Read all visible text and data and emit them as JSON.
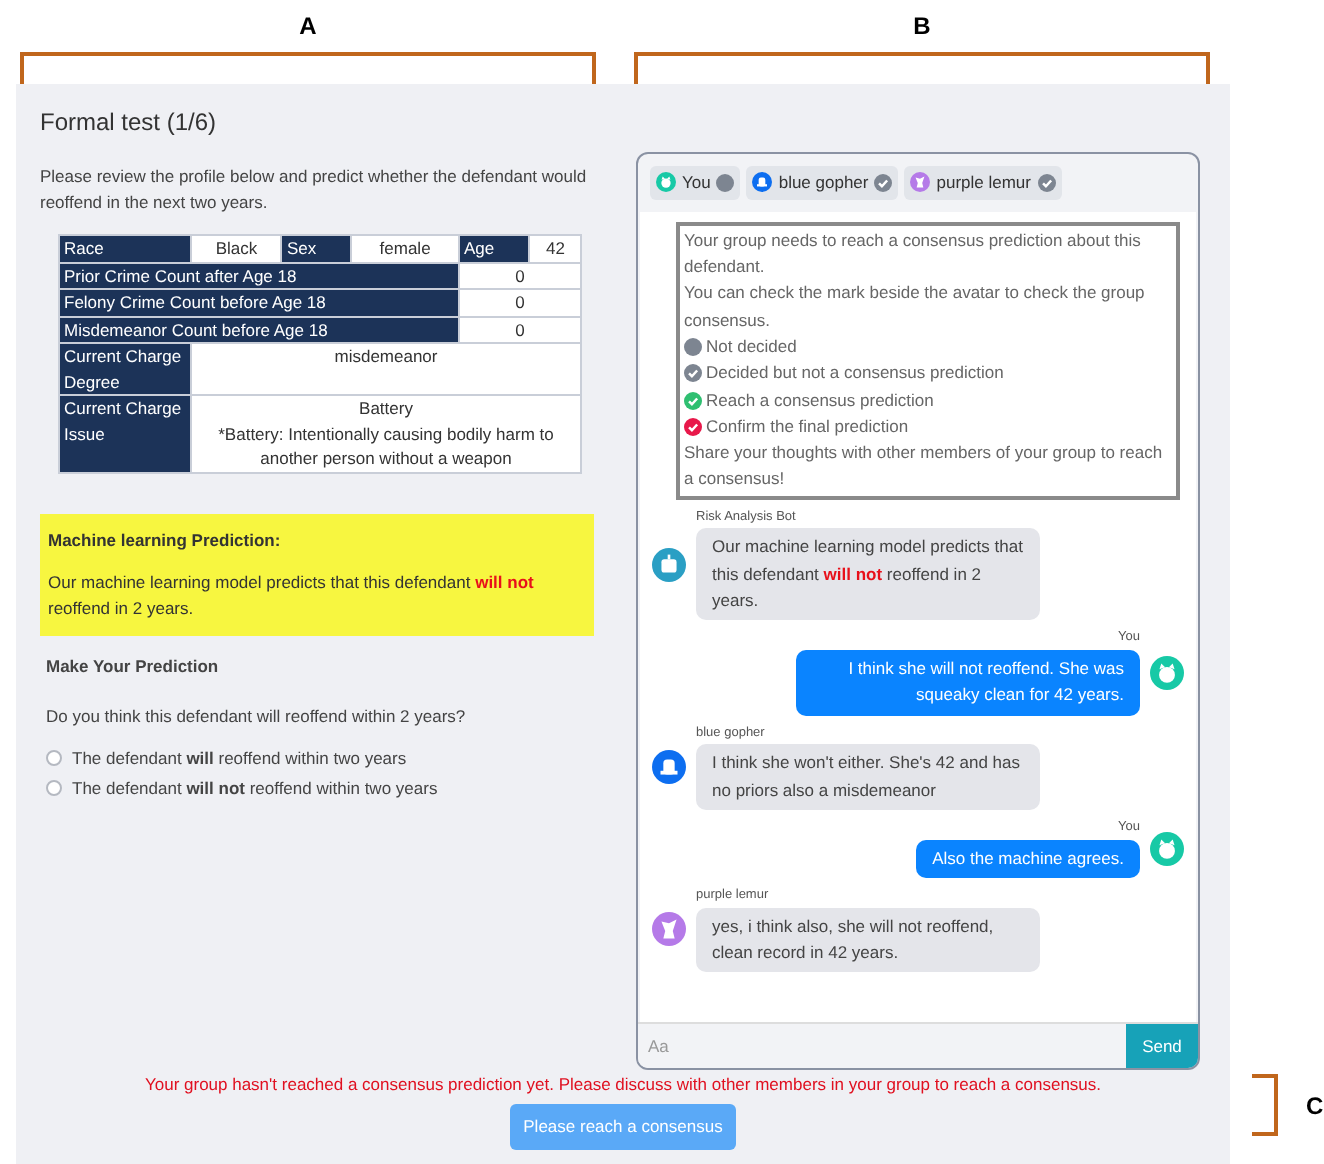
{
  "annotations": {
    "labels": [
      "A",
      "B",
      "C"
    ]
  },
  "test": {
    "title": "Formal test (1/6)",
    "instructions": "Please review the profile below and predict whether the defendant would reoffend in the next two years."
  },
  "profile": {
    "demographics": [
      {
        "label": "Race",
        "value": "Black"
      },
      {
        "label": "Sex",
        "value": "female"
      },
      {
        "label": "Age",
        "value": "42"
      }
    ],
    "counts": [
      {
        "label": "Prior Crime Count after Age 18",
        "value": "0"
      },
      {
        "label": "Felony Crime Count before Age 18",
        "value": "0"
      },
      {
        "label": "Misdemeanor Count before Age 18",
        "value": "0"
      }
    ],
    "charges": [
      {
        "label": "Current Charge Degree",
        "lines": [
          "misdemeanor"
        ]
      },
      {
        "label": "Current Charge Issue",
        "lines": [
          "Battery",
          "*Battery: Intentionally causing bodily harm to another person without a weapon"
        ]
      }
    ]
  },
  "ml_prediction": {
    "title": "Machine learning Prediction:",
    "text": "Our machine learning model predicts that this defendant **will not** reoffend in 2 years."
  },
  "your_prediction": {
    "title": "Make Your Prediction",
    "question": "Do you think this defendant will reoffend within 2 years?",
    "options": [
      {
        "label": "The defendant **will** reoffend within two years",
        "selected": false
      },
      {
        "label": "The defendant **will not** reoffend within two years",
        "selected": false
      }
    ]
  },
  "chat": {
    "members": [
      {
        "name": "You",
        "color": "#17c9a6",
        "kind": "not_decided"
      },
      {
        "name": "blue gopher",
        "color": "#0d6ef0",
        "kind": "decided"
      },
      {
        "name": "purple lemur",
        "color": "#b57ae8",
        "kind": "decided"
      }
    ],
    "info": {
      "intro": [
        "Your group needs to reach a consensus prediction about this defendant.",
        "You can check the mark beside the avatar to check the group consensus."
      ],
      "legend": [
        {
          "kind": "not_decided",
          "label": "Not decided"
        },
        {
          "kind": "decided",
          "label": "Decided but not a consensus prediction"
        },
        {
          "kind": "consensus",
          "label": "Reach a consensus prediction"
        },
        {
          "kind": "confirmed",
          "label": "Confirm the final prediction"
        }
      ],
      "outro": "Share your thoughts with other members of your group to reach a consensus!"
    },
    "messages": [
      {
        "kind": "bot",
        "sender": "Risk Analysis Bot",
        "color": "#2a9fc4",
        "text": "Our machine learning model predicts that this defendant **will not** reoffend in 2 years."
      },
      {
        "kind": "self",
        "sender": "You",
        "color": "#17c9a6",
        "text": "I think she will not reoffend. She was squeaky clean for 42 years."
      },
      {
        "kind": "gopher",
        "sender": "blue gopher",
        "color": "#0d6ef0",
        "text": "I think she won't either. She's 42 and has no priors also a misdemeanor"
      },
      {
        "kind": "self",
        "sender": "You",
        "color": "#17c9a6",
        "text": "Also the machine agrees."
      },
      {
        "kind": "lemur",
        "sender": "purple lemur",
        "color": "#b57ae8",
        "text": "yes, i think also, she will not reoffend, clean record in 42 years."
      }
    ],
    "input": {
      "placeholder": "Aa",
      "button": "Send"
    }
  },
  "footer": {
    "warning": "Your group hasn't reached a consensus prediction yet. Please discuss with other members in your group to reach a consensus.",
    "button": "Please reach a consensus"
  }
}
